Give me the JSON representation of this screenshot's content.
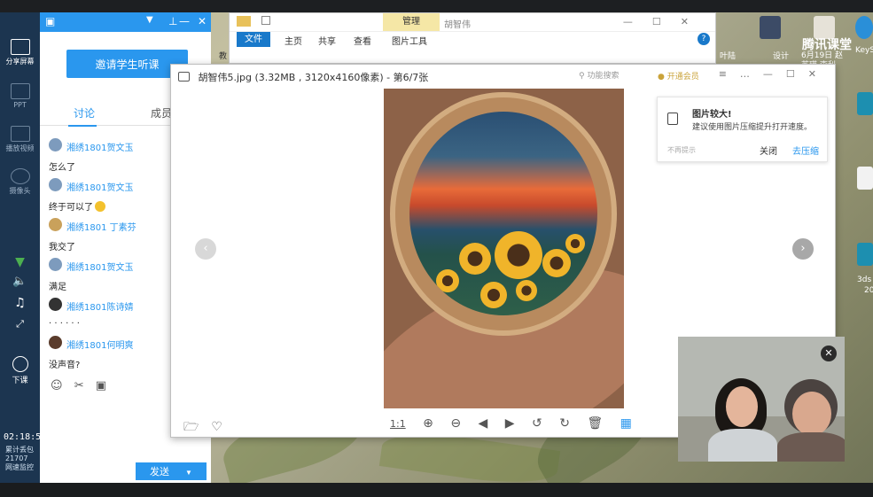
{
  "left_toolbar": {
    "share_screen": "分享屏幕",
    "ppt": "PPT",
    "play_video": "播放视频",
    "camera": "摄像头",
    "end_class": "下课",
    "clock": "02:18:54",
    "stats_line1": "累计丢包",
    "stats_line2": "21707",
    "stats_line3": "网速监控"
  },
  "chat": {
    "invite_button": "邀请学生听课",
    "tabs": [
      "讨论",
      "成员"
    ],
    "messages": [
      {
        "name": "湘绣1801贺文玉",
        "text": "怎么了"
      },
      {
        "name": "湘绣1801贺文玉",
        "text": "终于可以了"
      },
      {
        "name": "湘绣1801 丁素芬",
        "text": "我交了"
      },
      {
        "name": "湘绣1801贺文玉",
        "text": "满足"
      },
      {
        "name": "湘绣1801陈诗婧",
        "text": "· · · · · ·"
      },
      {
        "name": "湘绣1801何明爽",
        "text": "没声音?"
      }
    ],
    "send_button": "发送"
  },
  "explorer": {
    "manage_tab": "管理",
    "title": "胡智伟",
    "file_tab": "文件",
    "ribbon_tabs": [
      "主页",
      "共享",
      "查看",
      "图片工具"
    ]
  },
  "viewer": {
    "title": "胡智伟5.jpg (3.32MB , 3120x4160像素) - 第6/7张",
    "search_placeholder": "功能搜索",
    "vip_label": "开通会员",
    "ratio_label": "1:1",
    "notice": {
      "title": "图片较大!",
      "body": "建议使用图片压缩提升打开速度。",
      "no_more": "不再提示",
      "close": "关闭",
      "compress": "去压缩"
    }
  },
  "desktop": {
    "tencent_class": "腾讯课堂",
    "keyshot": "KeyS",
    "date_label": "6月19日 赵",
    "date_label2": "苏瑛 李利",
    "threeds": "3ds",
    "threeds2": "20",
    "icon1": "叶陆",
    "icon2": "设计",
    "icon3": "教"
  },
  "colors": {
    "accent": "#2a97ee",
    "left_bar": "#1c3550"
  }
}
